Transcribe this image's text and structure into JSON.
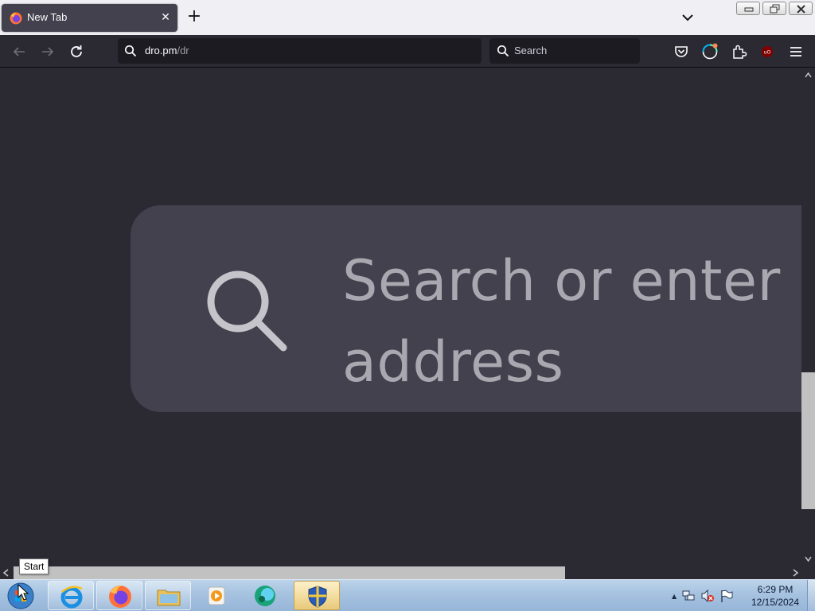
{
  "browser": {
    "tab": {
      "title": "New Tab",
      "close": "✕"
    },
    "new_tab": "+",
    "url": {
      "host": "dro.pm",
      "path": "/dr"
    },
    "search_placeholder": "Search"
  },
  "content": {
    "search_placeholder_line1": "Search or enter",
    "search_placeholder_line2": "address"
  },
  "taskbar": {
    "tooltip": "Start",
    "clock_time": "6:29 PM",
    "clock_date": "12/15/2024",
    "tray_expand": "▲"
  },
  "colors": {
    "content_bg": "#2b2a33",
    "toolbar_bg": "#2b2a33",
    "field_bg": "#1c1b22",
    "big_search_bg": "#42414d",
    "tabstrip_bg": "#f0f0f4"
  }
}
